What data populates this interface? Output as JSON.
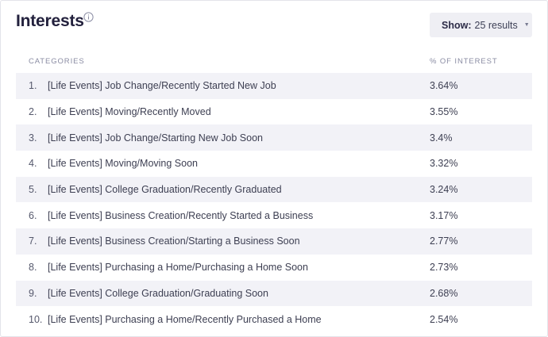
{
  "header": {
    "title": "Interests",
    "show_label": "Show:",
    "show_value": "25 results"
  },
  "table": {
    "columns": [
      "CATEGORIES",
      "% OF INTEREST"
    ],
    "rows": [
      {
        "num": "1.",
        "category": "[Life Events] Job Change/Recently Started New Job",
        "percent": "3.64%"
      },
      {
        "num": "2.",
        "category": "[Life Events] Moving/Recently Moved",
        "percent": "3.55%"
      },
      {
        "num": "3.",
        "category": "[Life Events] Job Change/Starting New Job Soon",
        "percent": "3.4%"
      },
      {
        "num": "4.",
        "category": "[Life Events] Moving/Moving Soon",
        "percent": "3.32%"
      },
      {
        "num": "5.",
        "category": "[Life Events] College Graduation/Recently Graduated",
        "percent": "3.24%"
      },
      {
        "num": "6.",
        "category": "[Life Events] Business Creation/Recently Started a Business",
        "percent": "3.17%"
      },
      {
        "num": "7.",
        "category": "[Life Events] Business Creation/Starting a Business Soon",
        "percent": "2.77%"
      },
      {
        "num": "8.",
        "category": "[Life Events] Purchasing a Home/Purchasing a Home Soon",
        "percent": "2.73%"
      },
      {
        "num": "9.",
        "category": "[Life Events] College Graduation/Graduating Soon",
        "percent": "2.68%"
      },
      {
        "num": "10.",
        "category": "[Life Events] Purchasing a Home/Recently Purchased a Home",
        "percent": "2.54%"
      }
    ]
  },
  "icons": {
    "info": "info-circle-icon",
    "dropdown": "caret-down-icon"
  },
  "colors": {
    "title": "#23213d",
    "row_shade": "#f2f2f7",
    "button_bg": "#efeff4",
    "header_text": "#8a8ca3"
  }
}
